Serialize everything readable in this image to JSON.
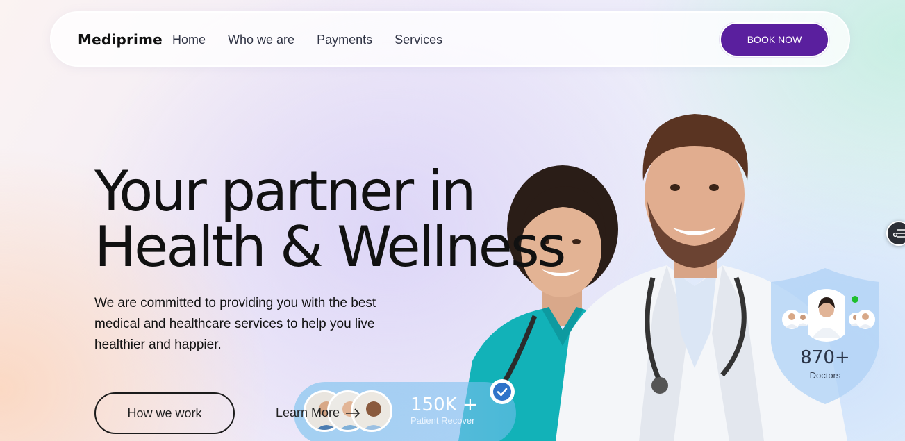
{
  "nav": {
    "brand": "Mediprime",
    "links": [
      "Home",
      "Who we are",
      "Payments",
      "Services"
    ],
    "cta": "BOOK NOW"
  },
  "hero": {
    "title_line1": "Your partner in",
    "title_line2": "Health & Wellness",
    "description": "We are committed to providing you with the best medical and healthcare services to help you live healthier and happier.",
    "primary_button": "How we work",
    "secondary_link": "Learn More"
  },
  "stats": {
    "patients_count": "150K +",
    "patients_label": "Patient Recover",
    "doctors_count": "870+",
    "doctors_label": "Doctors"
  },
  "colors": {
    "accent": "#5a1f9e",
    "nurse_scrubs": "#12b2b8",
    "card_blue": "#8cc8f0"
  },
  "icons": {
    "check": "check-icon",
    "arrow": "arrow-right-icon",
    "side_widget": "settings-list-icon"
  }
}
